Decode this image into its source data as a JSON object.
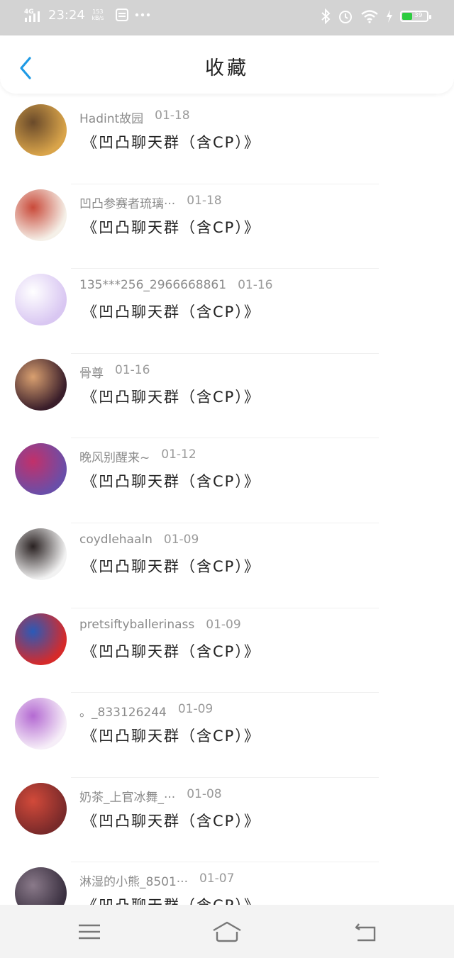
{
  "status_bar": {
    "network": "4G HD",
    "time": "23:24",
    "speed": "153 kB/s",
    "battery": "39",
    "battery_level": 0.39,
    "battery_color": "#2ecc40",
    "icons": [
      "signal-icon",
      "notification-icon",
      "more-dots-icon",
      "bluetooth-icon",
      "alarm-icon",
      "wifi-icon",
      "charging-icon",
      "battery-icon"
    ]
  },
  "header": {
    "title": "收藏",
    "back_icon": "chevron-left-icon",
    "accent": "#1e9ae5"
  },
  "items": [
    {
      "name": "Hadint故园",
      "date": "01-18",
      "content": "《凹凸聊天群（含CP）》",
      "avatar_colors": [
        "#d9a44a",
        "#6a4a2a"
      ]
    },
    {
      "name": "凹凸参赛者琉璃···",
      "date": "01-18",
      "content": "《凹凸聊天群（含CP）》",
      "avatar_colors": [
        "#f5f0e8",
        "#c94a3a"
      ]
    },
    {
      "name": "135***256_2966668861",
      "date": "01-16",
      "content": "《凹凸聊天群（含CP）》",
      "avatar_colors": [
        "#d9c7f2",
        "#ffffff"
      ]
    },
    {
      "name": "骨尊",
      "date": "01-16",
      "content": "《凹凸聊天群（含CP）》",
      "avatar_colors": [
        "#3a1e2a",
        "#d9a070"
      ]
    },
    {
      "name": "晚风别醒来~",
      "date": "01-12",
      "content": "《凹凸聊天群（含CP）》",
      "avatar_colors": [
        "#6a4ea8",
        "#c2306a"
      ]
    },
    {
      "name": "coydlehaaln",
      "date": "01-09",
      "content": "《凹凸聊天群（含CP）》",
      "avatar_colors": [
        "#f2f2f2",
        "#2a2222"
      ]
    },
    {
      "name": "pretsiftyballerinass",
      "date": "01-09",
      "content": "《凹凸聊天群（含CP）》",
      "avatar_colors": [
        "#d62a2a",
        "#2a5ab8"
      ]
    },
    {
      "name": "。_833126244",
      "date": "01-09",
      "content": "《凹凸聊天群（含CP）》",
      "avatar_colors": [
        "#f6eef8",
        "#b46ad2"
      ]
    },
    {
      "name": "奶茶_上官冰舞_···",
      "date": "01-08",
      "content": "《凹凸聊天群（含CP）》",
      "avatar_colors": [
        "#7a2a2a",
        "#d24a3a"
      ]
    },
    {
      "name": "淋湿的小熊_8501···",
      "date": "01-07",
      "content": "《凹凸聊天群（含CP）》",
      "avatar_colors": [
        "#3a3040",
        "#8a7a8a"
      ]
    }
  ],
  "nav_bar": {
    "icons": [
      "menu-icon",
      "home-icon",
      "back-icon"
    ]
  }
}
